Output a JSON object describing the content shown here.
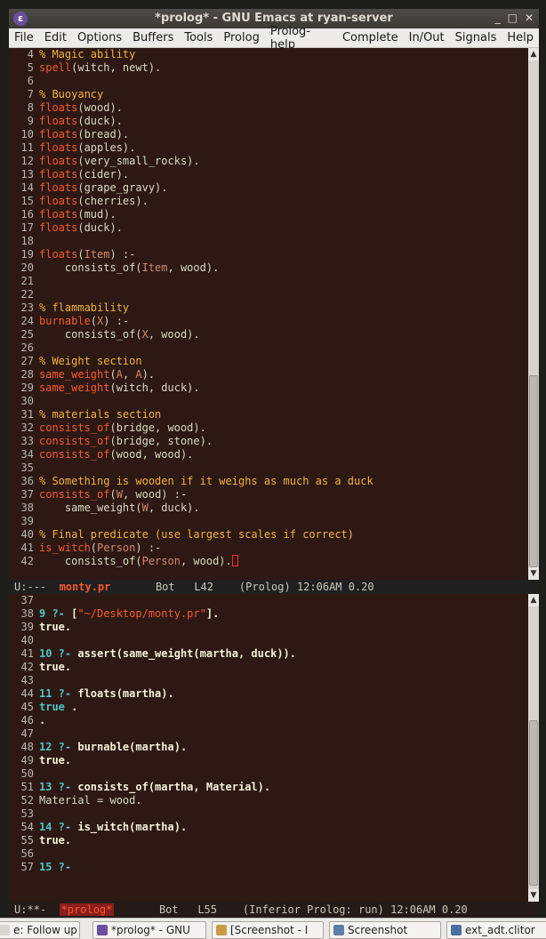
{
  "window": {
    "title": "*prolog* - GNU Emacs at ryan-server",
    "app_icon": "emacs-icon",
    "controls": [
      "_",
      "□",
      "✕"
    ]
  },
  "menu": [
    "File",
    "Edit",
    "Options",
    "Buffers",
    "Tools",
    "Prolog",
    "Prolog-help",
    "Complete",
    "In/Out",
    "Signals",
    "Help"
  ],
  "top_pane": {
    "lines": [
      {
        "n": "4",
        "segs": [
          [
            "cm",
            "% Magic ability"
          ]
        ]
      },
      {
        "n": "5",
        "segs": [
          [
            "fn",
            "spell"
          ],
          [
            "tx",
            "(witch, newt)."
          ]
        ]
      },
      {
        "n": "6",
        "segs": []
      },
      {
        "n": "7",
        "segs": [
          [
            "cm",
            "% Buoyancy"
          ]
        ]
      },
      {
        "n": "8",
        "segs": [
          [
            "fn",
            "floats"
          ],
          [
            "tx",
            "(wood)."
          ]
        ]
      },
      {
        "n": "9",
        "segs": [
          [
            "fn",
            "floats"
          ],
          [
            "tx",
            "(duck)."
          ]
        ]
      },
      {
        "n": "10",
        "segs": [
          [
            "fn",
            "floats"
          ],
          [
            "tx",
            "(bread)."
          ]
        ]
      },
      {
        "n": "11",
        "segs": [
          [
            "fn",
            "floats"
          ],
          [
            "tx",
            "(apples)."
          ]
        ]
      },
      {
        "n": "12",
        "segs": [
          [
            "fn",
            "floats"
          ],
          [
            "tx",
            "(very_small_rocks)."
          ]
        ]
      },
      {
        "n": "13",
        "segs": [
          [
            "fn",
            "floats"
          ],
          [
            "tx",
            "(cider)."
          ]
        ]
      },
      {
        "n": "14",
        "segs": [
          [
            "fn",
            "floats"
          ],
          [
            "tx",
            "(grape_gravy)."
          ]
        ]
      },
      {
        "n": "15",
        "segs": [
          [
            "fn",
            "floats"
          ],
          [
            "tx",
            "(cherries)."
          ]
        ]
      },
      {
        "n": "16",
        "segs": [
          [
            "fn",
            "floats"
          ],
          [
            "tx",
            "(mud)."
          ]
        ]
      },
      {
        "n": "17",
        "segs": [
          [
            "fn",
            "floats"
          ],
          [
            "tx",
            "(duck)."
          ]
        ]
      },
      {
        "n": "18",
        "segs": []
      },
      {
        "n": "19",
        "segs": [
          [
            "fn",
            "floats"
          ],
          [
            "tx",
            "("
          ],
          [
            "vr",
            "Item"
          ],
          [
            "tx",
            ") :-"
          ]
        ]
      },
      {
        "n": "20",
        "segs": [
          [
            "tx",
            "    consists_of("
          ],
          [
            "vr",
            "Item"
          ],
          [
            "tx",
            ", wood)."
          ]
        ]
      },
      {
        "n": "21",
        "segs": []
      },
      {
        "n": "22",
        "segs": []
      },
      {
        "n": "23",
        "segs": [
          [
            "cm",
            "% flammability"
          ]
        ]
      },
      {
        "n": "24",
        "segs": [
          [
            "fn",
            "burnable"
          ],
          [
            "tx",
            "("
          ],
          [
            "vr",
            "X"
          ],
          [
            "tx",
            ") :-"
          ]
        ]
      },
      {
        "n": "25",
        "segs": [
          [
            "tx",
            "    consists_of("
          ],
          [
            "vr",
            "X"
          ],
          [
            "tx",
            ", wood)."
          ]
        ]
      },
      {
        "n": "26",
        "segs": []
      },
      {
        "n": "27",
        "segs": [
          [
            "cm",
            "% Weight section"
          ]
        ]
      },
      {
        "n": "28",
        "segs": [
          [
            "fn",
            "same_weight"
          ],
          [
            "tx",
            "("
          ],
          [
            "vr",
            "A"
          ],
          [
            "tx",
            ", "
          ],
          [
            "vr",
            "A"
          ],
          [
            "tx",
            ")."
          ]
        ]
      },
      {
        "n": "29",
        "segs": [
          [
            "fn",
            "same_weight"
          ],
          [
            "tx",
            "(witch, duck)."
          ]
        ]
      },
      {
        "n": "30",
        "segs": []
      },
      {
        "n": "31",
        "segs": [
          [
            "cm",
            "% materials section"
          ]
        ]
      },
      {
        "n": "32",
        "segs": [
          [
            "fn",
            "consists_of"
          ],
          [
            "tx",
            "(bridge, wood)."
          ]
        ]
      },
      {
        "n": "33",
        "segs": [
          [
            "fn",
            "consists_of"
          ],
          [
            "tx",
            "(bridge, stone)."
          ]
        ]
      },
      {
        "n": "34",
        "segs": [
          [
            "fn",
            "consists_of"
          ],
          [
            "tx",
            "(wood, wood)."
          ]
        ]
      },
      {
        "n": "35",
        "segs": []
      },
      {
        "n": "36",
        "segs": [
          [
            "cm",
            "% Something is wooden if it weighs as much as a duck"
          ]
        ]
      },
      {
        "n": "37",
        "segs": [
          [
            "fn",
            "consists_of"
          ],
          [
            "tx",
            "("
          ],
          [
            "vr",
            "W"
          ],
          [
            "tx",
            ", wood) :-"
          ]
        ]
      },
      {
        "n": "38",
        "segs": [
          [
            "tx",
            "    same_weight("
          ],
          [
            "vr",
            "W"
          ],
          [
            "tx",
            ", duck)."
          ]
        ]
      },
      {
        "n": "39",
        "segs": []
      },
      {
        "n": "40",
        "segs": [
          [
            "cm",
            "% Final predicate (use largest scales if correct)"
          ]
        ]
      },
      {
        "n": "41",
        "segs": [
          [
            "fn",
            "is_witch"
          ],
          [
            "tx",
            "("
          ],
          [
            "vr",
            "Person"
          ],
          [
            "tx",
            ") :-"
          ]
        ]
      },
      {
        "n": "42",
        "segs": [
          [
            "tx",
            "    consists_of("
          ],
          [
            "vr",
            "Person"
          ],
          [
            "tx",
            ", wood)."
          ],
          [
            "cur",
            ""
          ]
        ]
      }
    ]
  },
  "modeline_top": {
    "status": "U:---",
    "buffer": "monty.pr",
    "pos": "Bot",
    "line": "L42",
    "mode": "(Prolog) 12:06AM 0.20"
  },
  "bottom_pane": {
    "lines": [
      {
        "n": "37",
        "segs": []
      },
      {
        "n": "38",
        "segs": [
          [
            "pr",
            "9 ?- "
          ],
          [
            "bd",
            "["
          ],
          [
            "fn",
            "\"~/Desktop/monty.pr\""
          ],
          [
            "bd",
            "]."
          ]
        ]
      },
      {
        "n": "39",
        "segs": [
          [
            "bd",
            "true."
          ]
        ]
      },
      {
        "n": "40",
        "segs": []
      },
      {
        "n": "41",
        "segs": [
          [
            "pr",
            "10 ?- "
          ],
          [
            "bd",
            "assert(same_weight(martha, duck))."
          ]
        ]
      },
      {
        "n": "42",
        "segs": [
          [
            "bd",
            "true."
          ]
        ]
      },
      {
        "n": "43",
        "segs": []
      },
      {
        "n": "44",
        "segs": [
          [
            "pr",
            "11 ?- "
          ],
          [
            "bd",
            "floats(martha)."
          ]
        ]
      },
      {
        "n": "45",
        "segs": [
          [
            "pr",
            "true "
          ],
          [
            "bd",
            "."
          ]
        ]
      },
      {
        "n": "46",
        "segs": [
          [
            "bd",
            "."
          ]
        ]
      },
      {
        "n": "47",
        "segs": []
      },
      {
        "n": "48",
        "segs": [
          [
            "pr",
            "12 ?- "
          ],
          [
            "bd",
            "burnable(martha)."
          ]
        ]
      },
      {
        "n": "49",
        "segs": [
          [
            "bd",
            "true."
          ]
        ]
      },
      {
        "n": "50",
        "segs": []
      },
      {
        "n": "51",
        "segs": [
          [
            "pr",
            "13 ?- "
          ],
          [
            "bd",
            "consists_of(martha, Material)."
          ]
        ]
      },
      {
        "n": "52",
        "segs": [
          [
            "tx",
            "Material = wood."
          ]
        ]
      },
      {
        "n": "53",
        "segs": []
      },
      {
        "n": "54",
        "segs": [
          [
            "pr",
            "14 ?- "
          ],
          [
            "bd",
            "is_witch(martha)."
          ]
        ]
      },
      {
        "n": "55",
        "segs": [
          [
            "bd",
            "true."
          ]
        ]
      },
      {
        "n": "56",
        "segs": []
      },
      {
        "n": "57",
        "segs": [
          [
            "pr",
            "15 ?- "
          ]
        ]
      }
    ]
  },
  "modeline_bottom": {
    "status": "U:**-",
    "buffer": "*prolog*",
    "pos": "Bot",
    "line": "L55",
    "mode": "(Inferior Prolog: run) 12:06AM 0.20"
  },
  "taskbar": [
    {
      "label": "e: Follow up",
      "icon": "document-icon"
    },
    {
      "label": "*prolog* - GNU",
      "icon": "emacs-icon"
    },
    {
      "label": "[Screenshot - I",
      "icon": "folder-icon"
    },
    {
      "label": "Screenshot",
      "icon": "screenshot-icon"
    },
    {
      "label": "ext_adt.clitor",
      "icon": "editor-icon"
    }
  ]
}
